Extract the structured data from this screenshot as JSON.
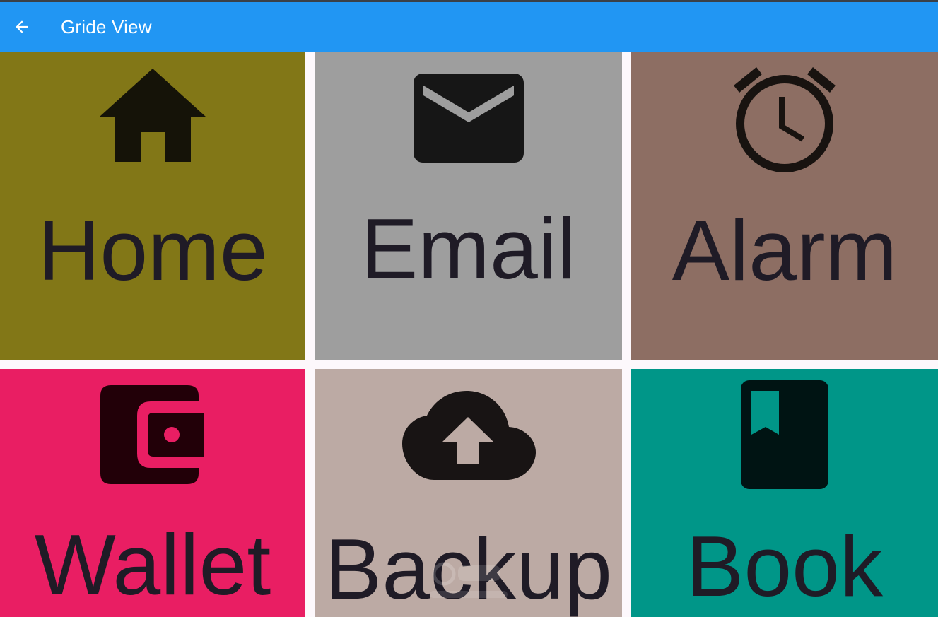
{
  "appbar": {
    "title": "Gride View",
    "back_icon": "arrow-back-icon",
    "background": "#2196f3"
  },
  "tiles": [
    {
      "label": "Home",
      "icon": "home-icon",
      "color": "#827717"
    },
    {
      "label": "Email",
      "icon": "email-icon",
      "color": "#9e9e9e"
    },
    {
      "label": "Alarm",
      "icon": "alarm-icon",
      "color": "#8d6e63"
    },
    {
      "label": "Wallet",
      "icon": "wallet-icon",
      "color": "#e91e63"
    },
    {
      "label": "Backup",
      "icon": "cloud-upload-icon",
      "color": "#bcaaa4"
    },
    {
      "label": "Book",
      "icon": "book-icon",
      "color": "#009688"
    }
  ]
}
